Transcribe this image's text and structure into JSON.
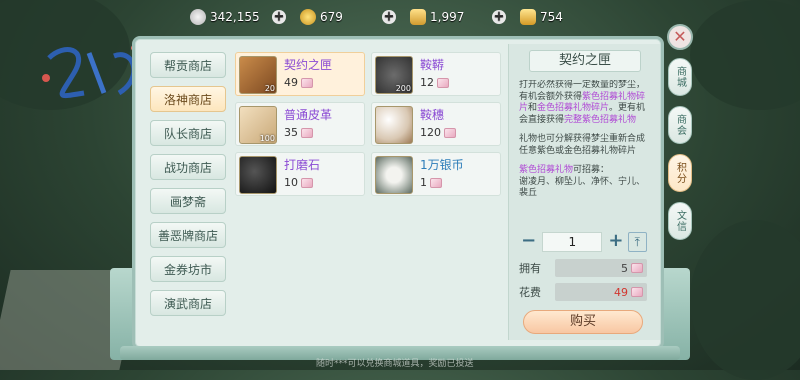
{
  "currencies": [
    {
      "icon": "silver-coin-icon",
      "value": "342,155",
      "color": "#d9d9d9"
    },
    {
      "icon": "gold-coin-icon",
      "value": "679",
      "color": "#f0c23a"
    },
    {
      "icon": "gold-ingot-icon",
      "value": "1,997",
      "color": "#e7b649"
    },
    {
      "icon": "gold-ingot-stack-icon",
      "value": "754",
      "color": "#f3c448"
    }
  ],
  "nav": {
    "items": [
      {
        "label": "帮贡商店",
        "active": false
      },
      {
        "label": "洛神商店",
        "active": true
      },
      {
        "label": "队长商店",
        "active": false
      },
      {
        "label": "战功商店",
        "active": false
      },
      {
        "label": "画梦斋",
        "active": false
      },
      {
        "label": "善恶牌商店",
        "active": false
      },
      {
        "label": "金券坊市",
        "active": false
      },
      {
        "label": "演武商店",
        "active": false
      }
    ]
  },
  "items": [
    {
      "name": "契约之匣",
      "price": "49",
      "count": "20",
      "color": "purple",
      "selected": true,
      "icon": "contract-box-icon"
    },
    {
      "name": "鞍鞯",
      "price": "12",
      "count": "200",
      "color": "purple",
      "selected": false,
      "icon": "saddle-icon"
    },
    {
      "name": "普通皮革",
      "price": "35",
      "count": "100",
      "color": "purple",
      "selected": false,
      "icon": "leather-icon"
    },
    {
      "name": "鞍穗",
      "price": "120",
      "count": "",
      "color": "purple",
      "selected": false,
      "icon": "tassel-icon"
    },
    {
      "name": "打磨石",
      "price": "10",
      "count": "",
      "color": "purple",
      "selected": false,
      "icon": "whetstone-icon"
    },
    {
      "name": "1万银币",
      "price": "1",
      "count": "",
      "color": "blue",
      "selected": false,
      "icon": "silver-coin-icon"
    }
  ],
  "detail": {
    "title": "契约之匣",
    "desc1_a": "打开必然获得一定数量的梦尘，有机会额外获得",
    "desc1_hl1": "紫色招募礼物碎片",
    "desc1_b": "和",
    "desc1_hl2": "金色招募礼物碎片",
    "desc1_c": "。更有机会直接获得",
    "desc1_hl3": "完整紫色招募礼物",
    "desc2": "礼物也可分解获得梦尘重新合成任意紫色或金色招募礼物碎片",
    "desc3_hl": "紫色招募礼物",
    "desc3_b": "可招募：",
    "desc4": "谢凌月、柳坠儿、净怀、宁儿、裴丘",
    "qty": "1",
    "own_label": "拥有",
    "own_value": "5",
    "cost_label": "花费",
    "cost_value": "49",
    "buy_label": "购买"
  },
  "side_tabs": [
    {
      "label": "商城",
      "active": false
    },
    {
      "label": "商会",
      "active": false
    },
    {
      "label": "积分",
      "active": true
    },
    {
      "label": "文信",
      "active": false
    }
  ],
  "bottom_note": "随时***可以兑换商城道具，奖励已投送"
}
